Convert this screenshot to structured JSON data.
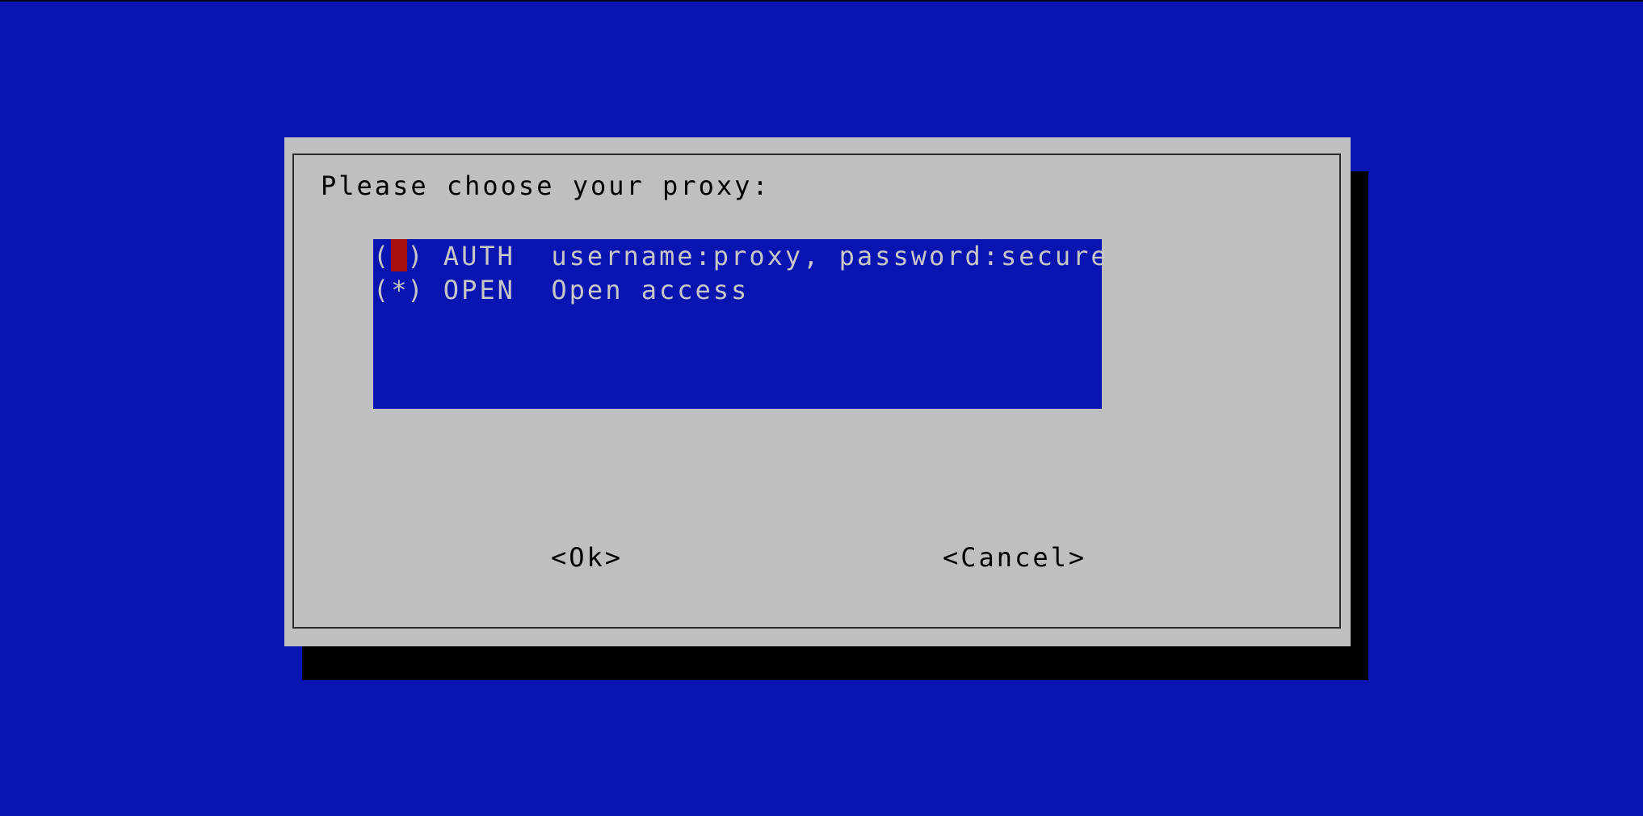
{
  "colors": {
    "background": "#0a14b0",
    "dialog": "#bfbfbf",
    "list_background": "#0a14b0",
    "list_text": "#c7c7c7",
    "cursor": "#a50f0f",
    "shadow": "#000000"
  },
  "dialog": {
    "prompt": "Please choose your proxy:",
    "options": [
      {
        "open": "(",
        "mark": " ",
        "close": ")",
        "tag": "AUTH",
        "description": "username:proxy, password:secure",
        "selected": false,
        "cursor": true
      },
      {
        "open": "(",
        "mark": "*",
        "close": ")",
        "tag": "OPEN",
        "description": "Open access",
        "selected": true,
        "cursor": false
      }
    ],
    "ok_label": "<Ok>",
    "cancel_label": "<Cancel>"
  }
}
